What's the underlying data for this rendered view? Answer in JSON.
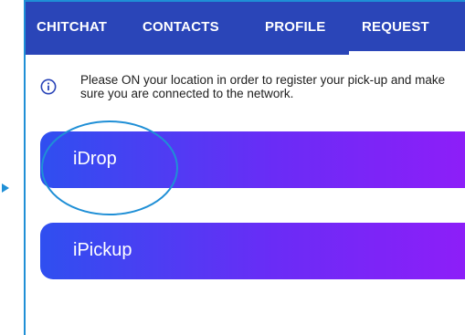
{
  "tabs": [
    {
      "label": "CHITCHAT"
    },
    {
      "label": "CONTACTS"
    },
    {
      "label": "PROFILE"
    },
    {
      "label": "REQUEST"
    }
  ],
  "active_tab": "REQUEST",
  "info": {
    "icon": "info-icon",
    "text": "Please ON your location in order to register your pick-up and make sure you are connected to the network."
  },
  "actions": [
    {
      "label": "iDrop",
      "highlighted": true
    },
    {
      "label": "iPickup",
      "highlighted": false
    }
  ],
  "colors": {
    "tab_bar": "#2a45b8",
    "frame_accent": "#1f8fd6",
    "button_gradient_start": "#2f4ff0",
    "button_gradient_end": "#8d1ef8"
  }
}
